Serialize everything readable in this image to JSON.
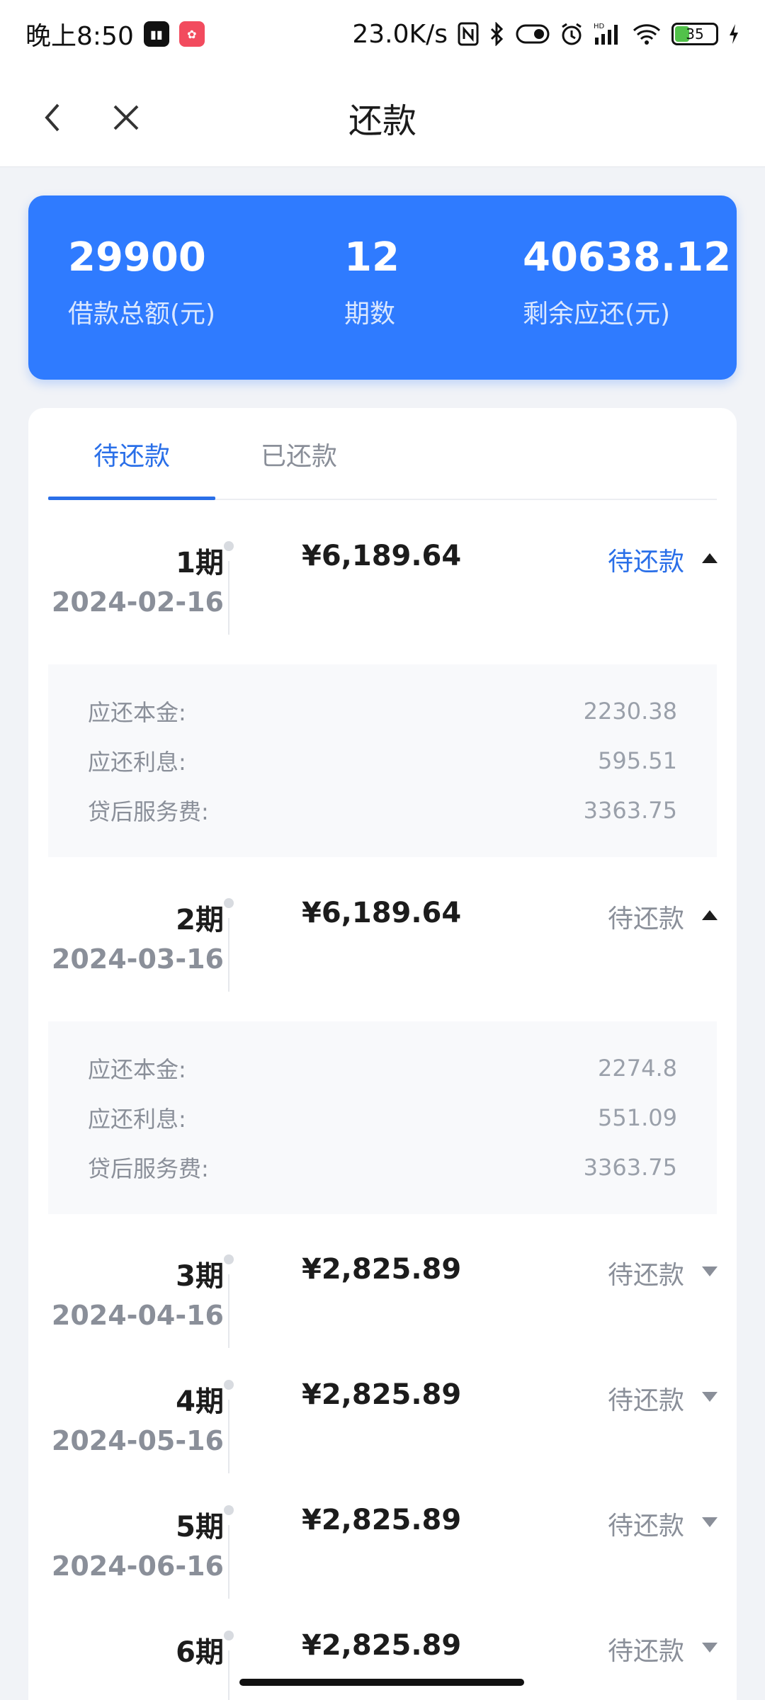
{
  "status_bar": {
    "time": "晚上8:50",
    "net_speed": "23.0K/s",
    "hd_label": "HD",
    "battery_level": "35",
    "battery_fraction": 0.35
  },
  "nav": {
    "title": "还款"
  },
  "summary": {
    "total_amount": "29900",
    "total_amount_label": "借款总额(元)",
    "periods": "12",
    "periods_label": "期数",
    "remaining": "40638.12",
    "remaining_label": "剩余应还(元)"
  },
  "tabs": [
    {
      "label": "待还款",
      "active": true
    },
    {
      "label": "已还款",
      "active": false
    }
  ],
  "detail_labels": {
    "principal": "应还本金:",
    "interest": "应还利息:",
    "service_fee": "贷后服务费:"
  },
  "periods": [
    {
      "label": "1期",
      "date": "2024-02-16",
      "amount": "¥6,189.64",
      "status": "待还款",
      "expanded": true,
      "principal": "2230.38",
      "interest": "595.51",
      "service_fee": "3363.75"
    },
    {
      "label": "2期",
      "date": "2024-03-16",
      "amount": "¥6,189.64",
      "status": "待还款",
      "expanded": true,
      "principal": "2274.8",
      "interest": "551.09",
      "service_fee": "3363.75"
    },
    {
      "label": "3期",
      "date": "2024-04-16",
      "amount": "¥2,825.89",
      "status": "待还款",
      "expanded": false
    },
    {
      "label": "4期",
      "date": "2024-05-16",
      "amount": "¥2,825.89",
      "status": "待还款",
      "expanded": false
    },
    {
      "label": "5期",
      "date": "2024-06-16",
      "amount": "¥2,825.89",
      "status": "待还款",
      "expanded": false
    },
    {
      "label": "6期",
      "date": "",
      "amount": "¥2,825.89",
      "status": "待还款",
      "expanded": false
    }
  ],
  "colors": {
    "brand_blue": "#2f7bff",
    "active_blue": "#2a6fe8",
    "muted_text": "#8a8f99"
  }
}
